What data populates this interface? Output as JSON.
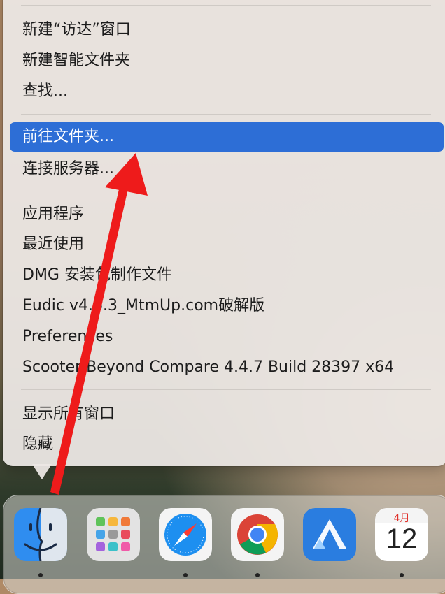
{
  "menu": {
    "items": [
      {
        "label": "新建“访达”窗口"
      },
      {
        "label": "新建智能文件夹"
      },
      {
        "label": "查找..."
      },
      {
        "label": "前往文件夹..."
      },
      {
        "label": "连接服务器..."
      },
      {
        "label": "应用程序"
      },
      {
        "label": "最近使用"
      },
      {
        "label": "DMG 安装包制作文件"
      },
      {
        "label": "Eudic v4.6.3_MtmUp.com破解版"
      },
      {
        "label": "Preferences"
      },
      {
        "label": "Scooter Beyond Compare 4.4.7 Build 28397 x64"
      },
      {
        "label": "显示所有窗口"
      },
      {
        "label": "隐藏"
      }
    ],
    "selected_index": 3
  },
  "dock": {
    "apps": [
      {
        "name": "Finder",
        "icon": "finder-icon",
        "running": true
      },
      {
        "name": "Launchpad",
        "icon": "launchpad-icon",
        "running": false
      },
      {
        "name": "Safari",
        "icon": "safari-icon",
        "running": true
      },
      {
        "name": "Chrome",
        "icon": "chrome-icon",
        "running": true
      },
      {
        "name": "Instruments",
        "icon": "mountain-app-icon",
        "running": false
      },
      {
        "name": "Calendar",
        "icon": "calendar-icon",
        "running": true
      }
    ],
    "calendar": {
      "month": "4月",
      "day": "12"
    }
  },
  "colors": {
    "selection": "#2d6ed6",
    "arrow": "#ee1b1b"
  }
}
